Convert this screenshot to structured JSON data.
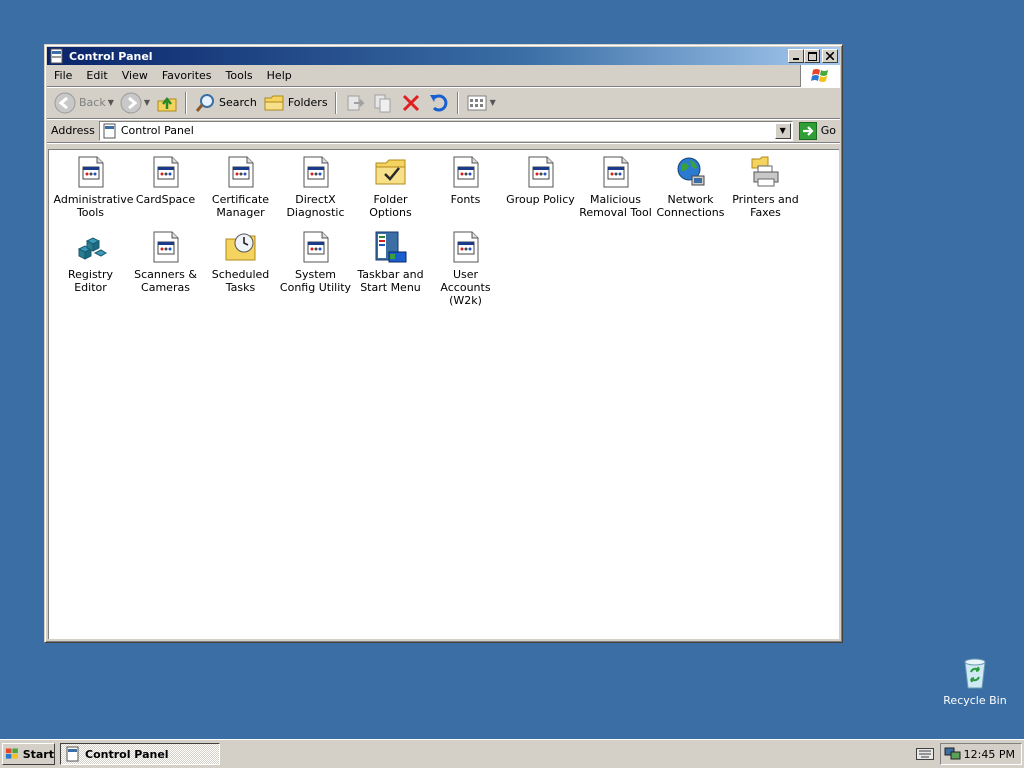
{
  "window": {
    "title": "Control Panel",
    "controls": {
      "minimize": "_",
      "maximize": "□",
      "close": "✕"
    }
  },
  "menu": [
    "File",
    "Edit",
    "View",
    "Favorites",
    "Tools",
    "Help"
  ],
  "toolbar": {
    "back": "Back",
    "search": "Search",
    "folders": "Folders"
  },
  "address": {
    "label": "Address",
    "value": "Control Panel",
    "go": "Go"
  },
  "items": [
    {
      "label": "Administrative Tools",
      "icon": "applet-icon"
    },
    {
      "label": "CardSpace",
      "icon": "applet-icon"
    },
    {
      "label": "Certificate Manager",
      "icon": "applet-icon"
    },
    {
      "label": "DirectX Diagnostic",
      "icon": "applet-icon"
    },
    {
      "label": "Folder Options",
      "icon": "folder-options-icon"
    },
    {
      "label": "Fonts",
      "icon": "applet-icon"
    },
    {
      "label": "Group Policy",
      "icon": "applet-icon"
    },
    {
      "label": "Malicious Removal Tool",
      "icon": "applet-icon"
    },
    {
      "label": "Network Connections",
      "icon": "network-globe-icon"
    },
    {
      "label": "Printers and Faxes",
      "icon": "printer-icon"
    },
    {
      "label": "Registry Editor",
      "icon": "registry-icon"
    },
    {
      "label": "Scanners & Cameras",
      "icon": "applet-icon"
    },
    {
      "label": "Scheduled Tasks",
      "icon": "scheduled-tasks-icon"
    },
    {
      "label": "System Config Utility",
      "icon": "applet-icon"
    },
    {
      "label": "Taskbar and Start Menu",
      "icon": "taskbar-icon"
    },
    {
      "label": "User Accounts (W2k)",
      "icon": "applet-icon"
    }
  ],
  "desktop": {
    "recycle_bin": "Recycle Bin"
  },
  "taskbar": {
    "start": "Start",
    "task": "Control Panel",
    "clock": "12:45 PM"
  },
  "colors": {
    "desktop": "#3a6ea5",
    "title_active": "#0a246a",
    "chrome": "#d4d0c8"
  }
}
